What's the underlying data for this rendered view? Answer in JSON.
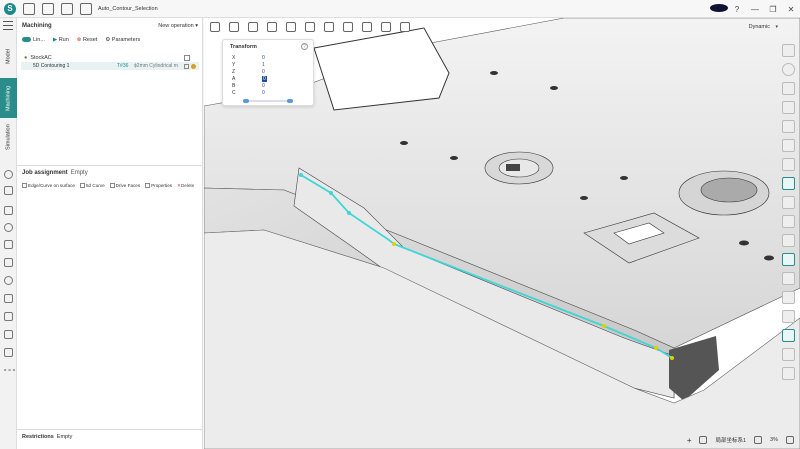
{
  "titlebar": {
    "file_name": "Auto_Contour_Selection",
    "window_controls": [
      "?",
      "—",
      "❐",
      "✕"
    ]
  },
  "vtabs": {
    "model": "Model",
    "machining": "Machining",
    "simulation": "Simulation"
  },
  "panel": {
    "heading": "Machining",
    "new_operation": "New operation",
    "live_label": "Lin...",
    "run_label": "Run",
    "reset_label": "Reset",
    "parameters_label": "Parameters",
    "stock_label": "StockAC",
    "operation": {
      "name": "5D Contouring 1",
      "tool": "T#36",
      "desc": "ϕ2mm Cylindrical m"
    },
    "job_assignment": "Job assignment",
    "job_status": "Empty",
    "job_tools": [
      "Edge/Curve on surface",
      "5d Curve",
      "Drive Faces",
      "Properties",
      "Delete"
    ],
    "restrictions": "Restrictions",
    "restrictions_status": "Empty"
  },
  "viewport": {
    "view_mode": "Dynamic",
    "transform": {
      "title": "Transform",
      "rows": [
        {
          "axis": "X",
          "value": "0"
        },
        {
          "axis": "Y",
          "value": "1"
        },
        {
          "axis": "Z",
          "value": "0"
        },
        {
          "axis": "A",
          "value": "0"
        },
        {
          "axis": "B",
          "value": "0"
        },
        {
          "axis": "C",
          "value": "0"
        }
      ]
    },
    "status": {
      "units": "局部坐标系1",
      "zoom": "3%"
    }
  },
  "colors": {
    "accent": "#2b8c8c",
    "toolpath": "#3fd6d6",
    "reset": "#cc3333",
    "value": "#1a4e9a"
  }
}
